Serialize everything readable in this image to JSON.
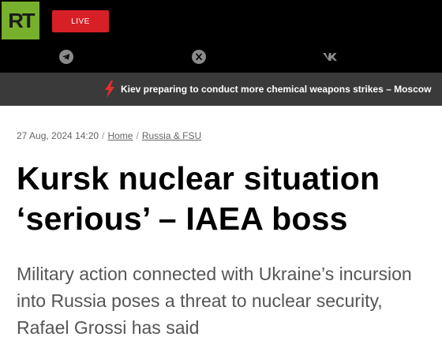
{
  "header": {
    "logo_text": "RT",
    "live_label": "LIVE",
    "social_icons": [
      "telegram-icon",
      "x-icon",
      "vk-icon"
    ]
  },
  "ticker": {
    "icon": "lightning-icon",
    "text": "Kiev preparing to conduct more chemical weapons strikes – Moscow"
  },
  "article": {
    "date": "27 Aug, 2024 14:20",
    "breadcrumbs": [
      "Home",
      "Russia & FSU"
    ],
    "headline": "Kursk nuclear situation ‘serious’ – IAEA boss",
    "summary": "Military action connected with Ukraine’s incursion into Russia poses a threat to nuclear security, Rafael Grossi has said"
  },
  "colors": {
    "brand_green": "#77b02c",
    "live_red": "#d71f26",
    "ticker_bg": "#3a3a3a",
    "lightning_red": "#e4302b"
  }
}
